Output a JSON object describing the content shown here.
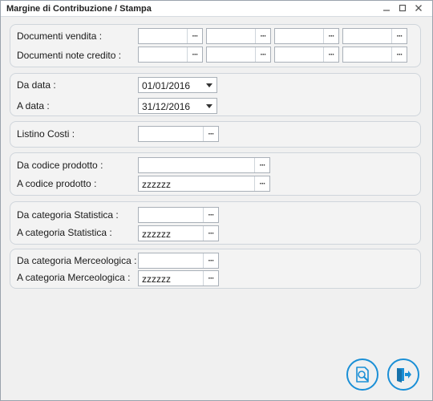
{
  "window": {
    "title": "Margine di Contribuzione / Stampa"
  },
  "documenti": {
    "vendita_label": "Documenti vendita :",
    "note_credito_label": "Documenti note credito :",
    "vendita_values": [
      "",
      "",
      "",
      ""
    ],
    "note_credito_values": [
      "",
      "",
      "",
      ""
    ]
  },
  "date": {
    "da_label": "Da data :",
    "a_label": "A data :",
    "da_value": "01/01/2016",
    "a_value": "31/12/2016"
  },
  "listino": {
    "label": "Listino Costi :",
    "value": ""
  },
  "prodotto": {
    "da_label": "Da codice prodotto :",
    "a_label": "A codice prodotto :",
    "da_value": "",
    "a_value": "zzzzzz"
  },
  "statistica": {
    "da_label": "Da categoria Statistica :",
    "a_label": "A categoria Statistica :",
    "da_value": "",
    "a_value": "zzzzzz"
  },
  "merceologica": {
    "da_label": "Da categoria Merceologica :",
    "a_label": "A categoria Merceologica :",
    "da_value": "",
    "a_value": "zzzzzz"
  },
  "lookup_glyph": "···",
  "icons": {
    "preview": "print-preview-icon",
    "exit": "exit-door-icon",
    "minimize": "minimize-icon",
    "maximize": "maximize-icon",
    "close": "close-icon"
  },
  "colors": {
    "accent": "#1a8fd6",
    "panel": "#f3f3f3",
    "border": "#cfd5db"
  }
}
